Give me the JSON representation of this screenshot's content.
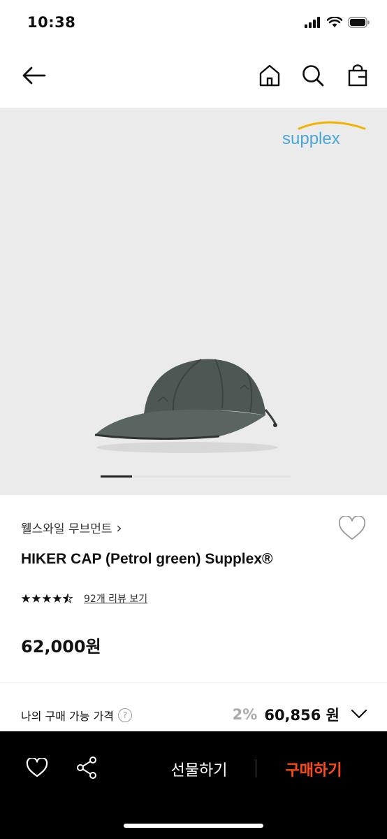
{
  "status_bar": {
    "time": "10:38"
  },
  "product_image": {
    "watermark": "supplex"
  },
  "brand": {
    "name": "웰스와일 무브먼트",
    "chevron": "›"
  },
  "product": {
    "name": "HIKER CAP (Petrol green) Supplex®",
    "rating": 4.5,
    "review_link": "92개 리뷰 보기",
    "price": "62,000원"
  },
  "my_price": {
    "label": "나의 구매 가능 가격",
    "help": "?",
    "discount": "2%",
    "price": "60,856 원"
  },
  "bottom_bar": {
    "gift_label": "선물하기",
    "buy_label": "구매하기"
  },
  "colors": {
    "accent": "#ff4a16",
    "image_bg": "#ebebeb",
    "bottom_bar_bg": "#000000"
  },
  "icons": {
    "nav": [
      "back-arrow-icon",
      "home-icon",
      "search-icon",
      "shopping-bag-icon"
    ],
    "bottom": [
      "heart-icon",
      "share-icon"
    ]
  }
}
